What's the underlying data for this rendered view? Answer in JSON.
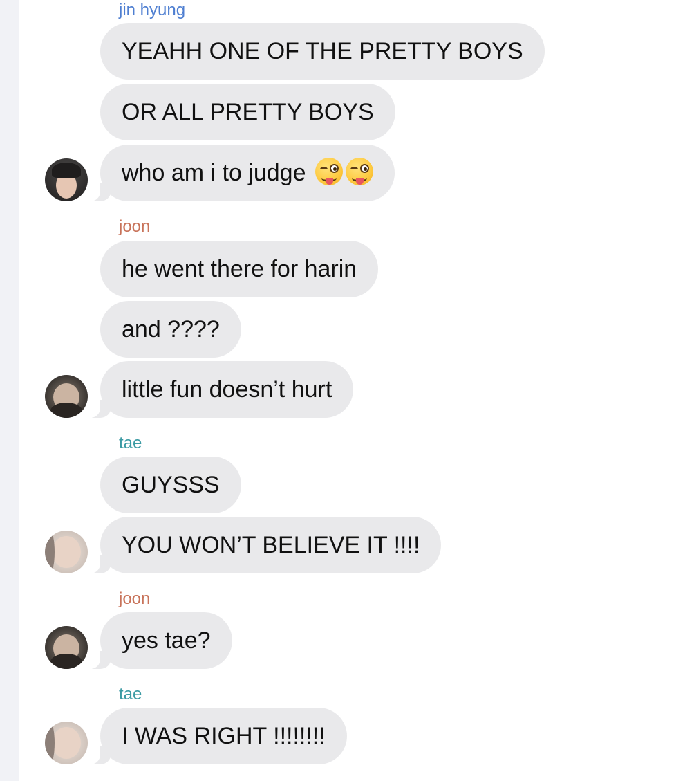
{
  "chat": {
    "groups": [
      {
        "sender": "jin hyung",
        "sender_color": "#4f7fd1",
        "avatar": "jin-avatar",
        "messages": [
          "YEAHH ONE OF THE PRETTY BOYS",
          "OR ALL PRETTY BOYS",
          "who am i to judge"
        ],
        "emoji": "winking-face-with-tongue-icon"
      },
      {
        "sender": "joon",
        "sender_color": "#c8735a",
        "avatar": "joon-avatar",
        "messages": [
          "he went there for harin",
          "and ????",
          "little fun doesn’t hurt"
        ]
      },
      {
        "sender": "tae",
        "sender_color": "#3a9aa3",
        "avatar": "tae-avatar",
        "messages": [
          "GUYSSS",
          "YOU WON’T BELIEVE IT !!!!"
        ]
      },
      {
        "sender": "joon",
        "sender_color": "#c8735a",
        "avatar": "joon-avatar",
        "messages": [
          "yes tae?"
        ]
      },
      {
        "sender": "tae",
        "sender_color": "#3a9aa3",
        "avatar": "tae-avatar",
        "messages": [
          "I WAS RIGHT !!!!!!!!"
        ]
      }
    ]
  }
}
